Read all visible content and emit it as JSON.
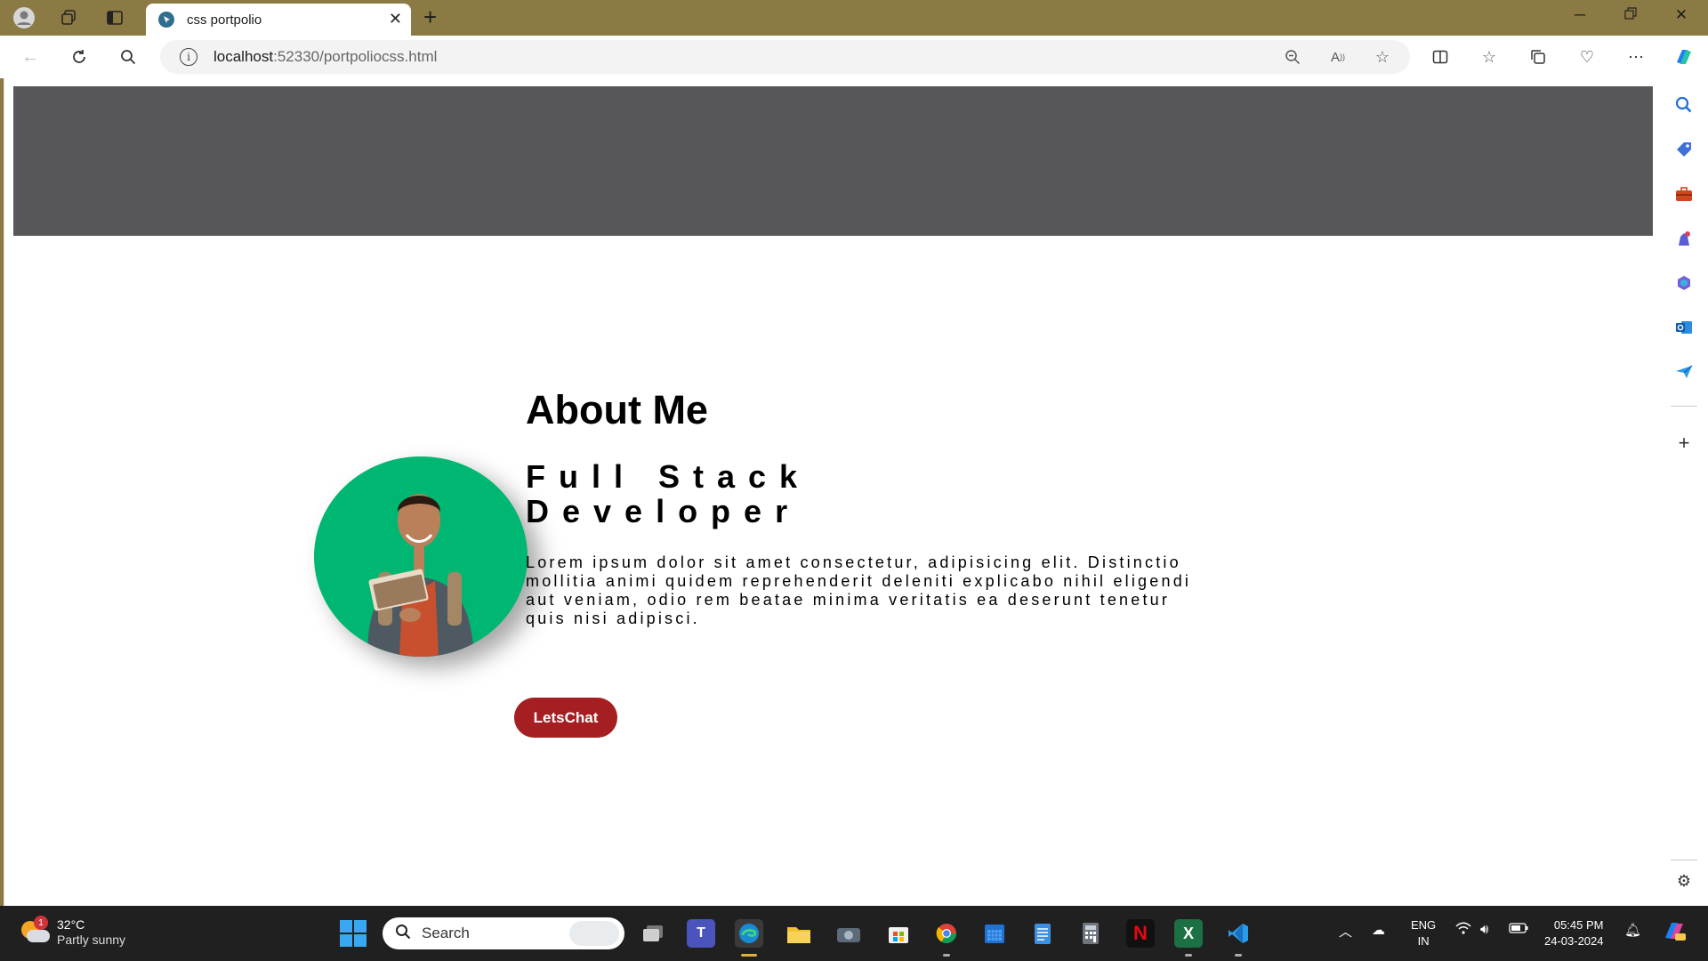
{
  "browser": {
    "tab_title": "css portpolio",
    "tab_favicon": "pin-icon",
    "new_tab": "+",
    "url_host": "localhost",
    "url_rest": ":52330/portpoliocss.html"
  },
  "page": {
    "about_title": "About Me",
    "role": "Full Stack Developer",
    "bio": "Lorem ipsum dolor sit amet consectetur, adipisicing elit. Distinctio mollitia animi quidem reprehenderit deleniti explicabo nihil eligendi aut veniam, odio rem beatae minima veritatis ea deserunt tenetur quis nisi adipisci.",
    "chat_button": "LetsChat",
    "header_color": "#575658",
    "avatar_color": "#00b673",
    "button_color": "#a51f22"
  },
  "taskbar": {
    "weather_badge": "1",
    "weather_temp": "32°C",
    "weather_desc": "Partly sunny",
    "search_placeholder": "Search",
    "lang_top": "ENG",
    "lang_bottom": "IN",
    "time": "05:45 PM",
    "date": "24-03-2024"
  },
  "colors": {
    "titlebar": "#8b7a43",
    "taskbar": "#202020"
  }
}
